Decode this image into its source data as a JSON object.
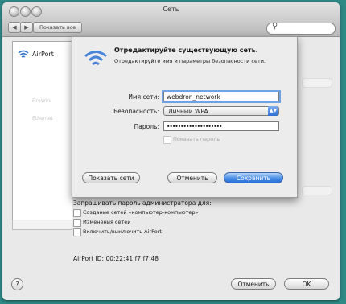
{
  "window": {
    "title": "Сеть",
    "show_all": "Показать все",
    "search_placeholder": ""
  },
  "sidebar": {
    "airport_label": "AirPort",
    "ghost_items": [
      "FireWire",
      "Ethernet"
    ]
  },
  "dialog": {
    "title": "Отредактируйте существующую сеть.",
    "subtitle": "Отредактируйте имя и параметры безопасности сети.",
    "network_name_label": "Имя сети:",
    "network_name_value": "webdron_network",
    "security_label": "Безопасность:",
    "security_value": "Личный WPA",
    "password_label": "Пароль:",
    "password_value": "••••••••••••••••••••",
    "show_password_label": "Показать пароль",
    "show_networks_button": "Показать сети",
    "cancel_button": "Отменить",
    "save_button": "Сохранить"
  },
  "settings": {
    "admin_prompt": "Запрашивать пароль администратора для:",
    "options": [
      "Создание сетей «компьютер-компьютер»",
      "Изменения сетей",
      "Включить/выключить AirPort"
    ],
    "airport_id": "AirPort ID: 00:22:41:f7:f7:48"
  },
  "footer": {
    "help": "?",
    "cancel_button": "Отменить",
    "ok_button": "OK"
  },
  "colors": {
    "desktop": "#2f8a86",
    "accent": "#2a6fd6",
    "focus_ring": "#6ea3e4"
  },
  "icons": {
    "airport": "wifi-icon",
    "search": "search-icon",
    "help": "help-icon"
  }
}
